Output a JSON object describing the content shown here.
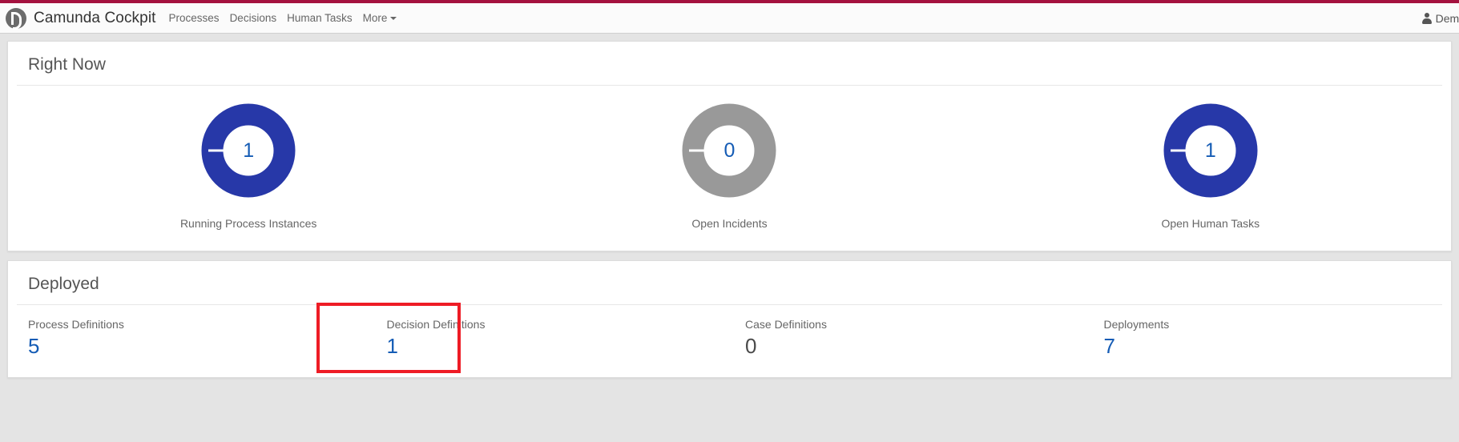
{
  "navbar": {
    "brand_title": "Camunda Cockpit",
    "logo_icon": "camunda-logo-icon",
    "links": [
      {
        "label": "Processes"
      },
      {
        "label": "Decisions"
      },
      {
        "label": "Human Tasks"
      }
    ],
    "more_label": "More",
    "more_caret_icon": "caret-down-icon",
    "user_icon": "user-icon",
    "user_name": "Demo",
    "accent_color": "#a4123f"
  },
  "right_now": {
    "title": "Right Now",
    "metrics": [
      {
        "label": "Running Process Instances",
        "value": "1",
        "ring_color": "#2738a8",
        "value_color": "#155cb5"
      },
      {
        "label": "Open Incidents",
        "value": "0",
        "ring_color": "#999999",
        "value_color": "#155cb5"
      },
      {
        "label": "Open Human Tasks",
        "value": "1",
        "ring_color": "#2738a8",
        "value_color": "#155cb5"
      }
    ]
  },
  "deployed": {
    "title": "Deployed",
    "stats": [
      {
        "label": "Process Definitions",
        "value": "5",
        "is_link": true
      },
      {
        "label": "Decision Definitions",
        "value": "1",
        "is_link": true
      },
      {
        "label": "Case Definitions",
        "value": "0",
        "is_link": false
      },
      {
        "label": "Deployments",
        "value": "7",
        "is_link": true
      }
    ],
    "highlight": {
      "target": "Decision Definitions",
      "color": "#ee1c25"
    }
  },
  "chart_data": {
    "type": "pie",
    "title": "Right Now",
    "charts": [
      {
        "name": "Running Process Instances",
        "value": 1,
        "color": "#2738a8"
      },
      {
        "name": "Open Incidents",
        "value": 0,
        "color": "#999999"
      },
      {
        "name": "Open Human Tasks",
        "value": 1,
        "color": "#2738a8"
      }
    ],
    "legend": "none",
    "grid": false
  }
}
